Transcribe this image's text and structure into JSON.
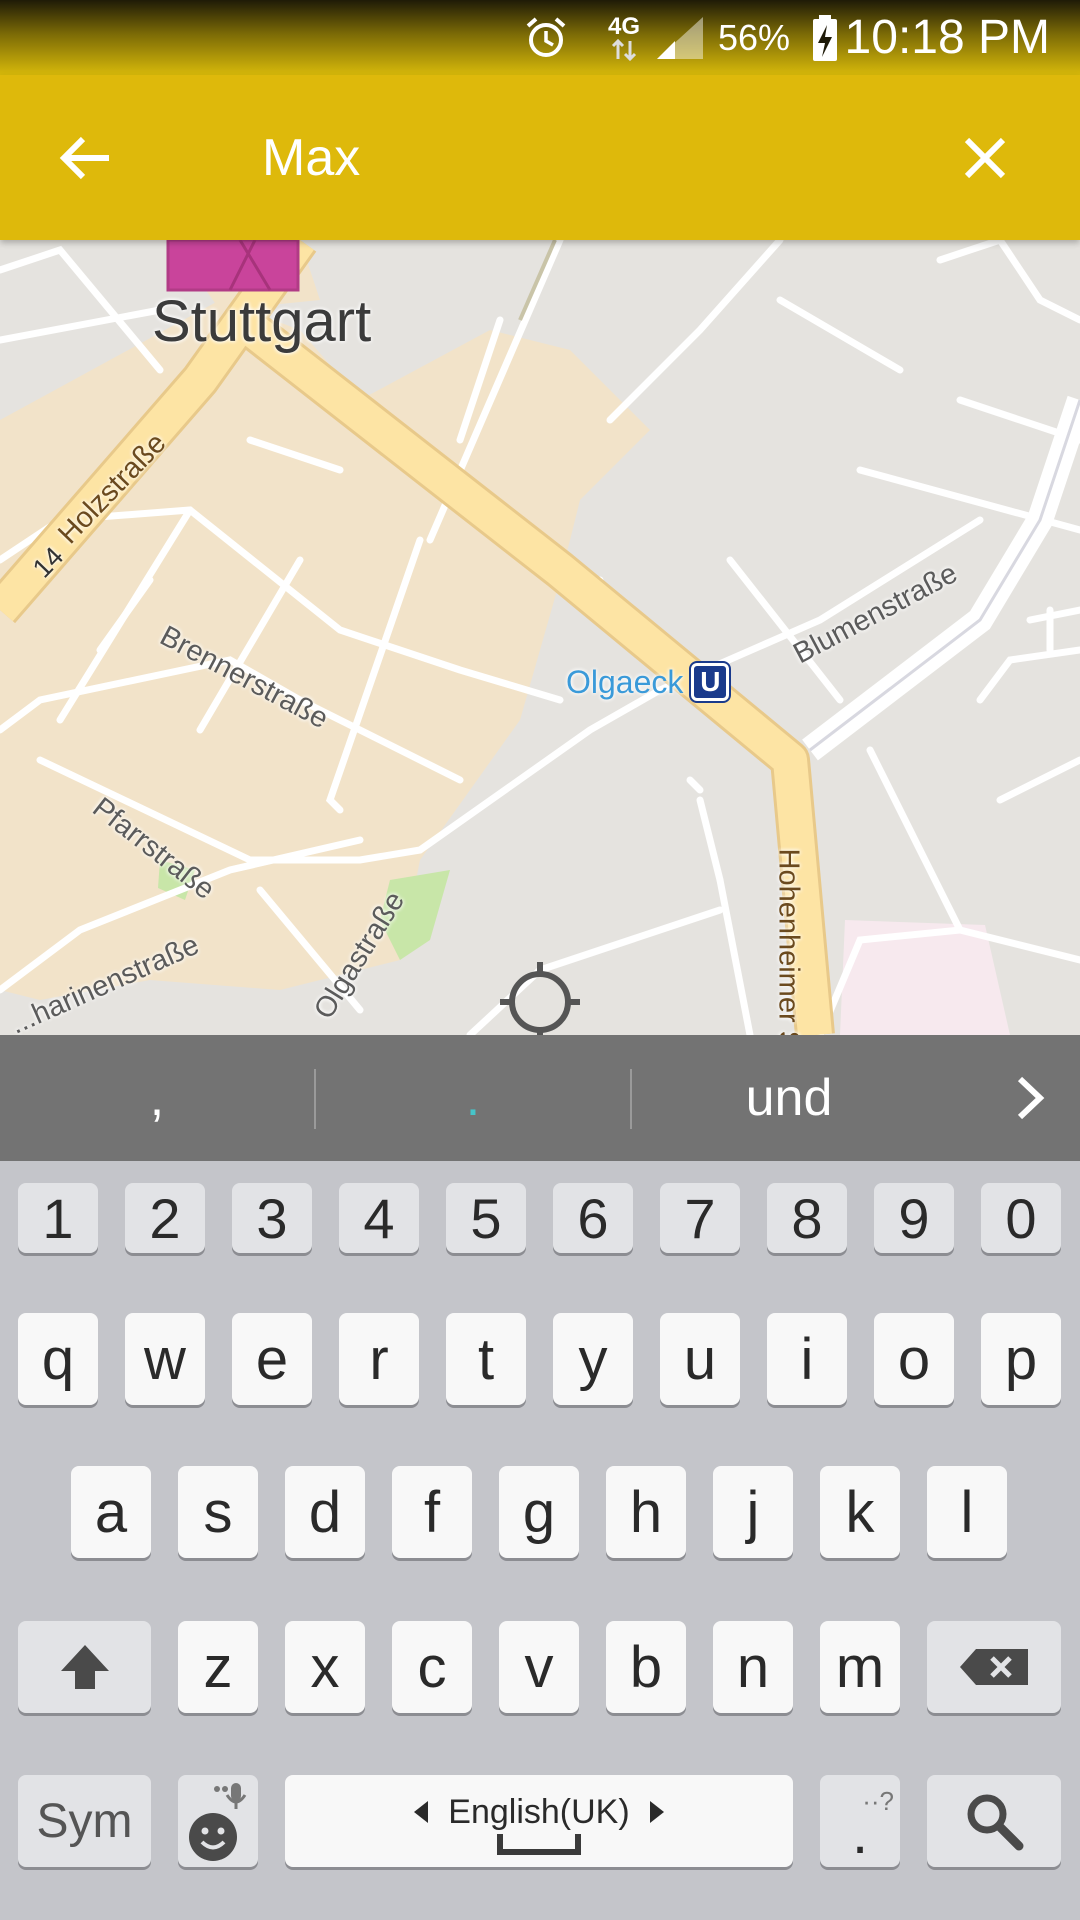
{
  "status_bar": {
    "time": "10:18 PM",
    "battery_percent": "56%",
    "network": "4G",
    "icons": [
      "alarm-icon",
      "4g-data-icon",
      "signal-icon",
      "battery-charging-icon"
    ]
  },
  "app_bar": {
    "search_value": "Max",
    "back_icon": "arrow-left-icon",
    "clear_icon": "close-icon"
  },
  "map": {
    "city": "Stuttgart",
    "streets": {
      "holzstrasse": "Holzstraße",
      "route_number": "14",
      "brennerstrasse": "Brennerstraße",
      "pfarrstrasse": "Pfarrstraße",
      "olgastrasse": "Olgastraße",
      "katharinenstrasse": "...harinenstraße",
      "blumenstrasse": "Blumenstraße",
      "hohenheimer": "Hohenheimer S..."
    },
    "station": {
      "name": "Olgaeck",
      "badge": "U"
    }
  },
  "suggestions": [
    ",",
    ".",
    "und"
  ],
  "keyboard": {
    "number_row": [
      "1",
      "2",
      "3",
      "4",
      "5",
      "6",
      "7",
      "8",
      "9",
      "0"
    ],
    "row1": [
      "q",
      "w",
      "e",
      "r",
      "t",
      "y",
      "u",
      "i",
      "o",
      "p"
    ],
    "row2": [
      "a",
      "s",
      "d",
      "f",
      "g",
      "h",
      "j",
      "k",
      "l"
    ],
    "row3": [
      "z",
      "x",
      "c",
      "v",
      "b",
      "n",
      "m"
    ],
    "sym_label": "Sym",
    "space_label": "English(UK)",
    "period_label": ".",
    "period_hint": "··?"
  },
  "colors": {
    "app_bar": "#deb90b",
    "suggestion_bar": "#737373",
    "keyboard_bg": "#c4c5ca",
    "map_bg": "#e5e3df",
    "urban_area": "#f2e3c9",
    "main_road": "#fde4a4",
    "transit_blue": "#3a9ad9"
  }
}
